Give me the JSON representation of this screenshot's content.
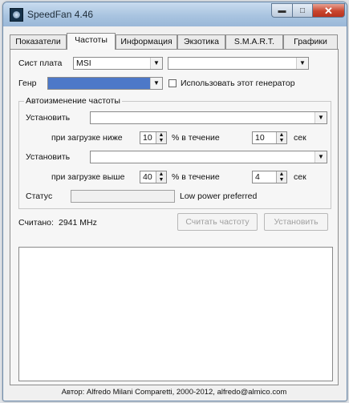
{
  "window": {
    "title": "SpeedFan 4.46"
  },
  "tabs": [
    {
      "label": "Показатели"
    },
    {
      "label": "Частоты"
    },
    {
      "label": "Информация"
    },
    {
      "label": "Экзотика"
    },
    {
      "label": "S.M.A.R.T."
    },
    {
      "label": "Графики"
    }
  ],
  "freq": {
    "board_label": "Сист плата",
    "board_value": "MSI",
    "board_model_value": "",
    "generator_label": "Генр",
    "generator_value": "",
    "use_generator_label": "Использовать этот генератор",
    "use_generator_checked": false,
    "auto_group_label": "Автоизменение частоты",
    "set_label_1": "Установить",
    "set_value_1": "",
    "low_load_label": "при загрузке ниже",
    "low_load_value": "10",
    "percent_during_1": "% в течение",
    "low_time_value": "10",
    "sec_1": "сек",
    "set_label_2": "Установить",
    "set_value_2": "",
    "high_load_label": "при загрузке выше",
    "high_load_value": "40",
    "percent_during_2": "% в течение",
    "high_time_value": "4",
    "sec_2": "сек",
    "status_label": "Статус",
    "status_text": "Low power preferred",
    "read_label": "Считано:",
    "read_value": "2941 MHz",
    "read_button": "Считать частоту",
    "set_button": "Установить"
  },
  "statusbar": {
    "text": "Автор: Alfredo Milani Comparetti, 2000-2012, alfredo@almico.com"
  }
}
